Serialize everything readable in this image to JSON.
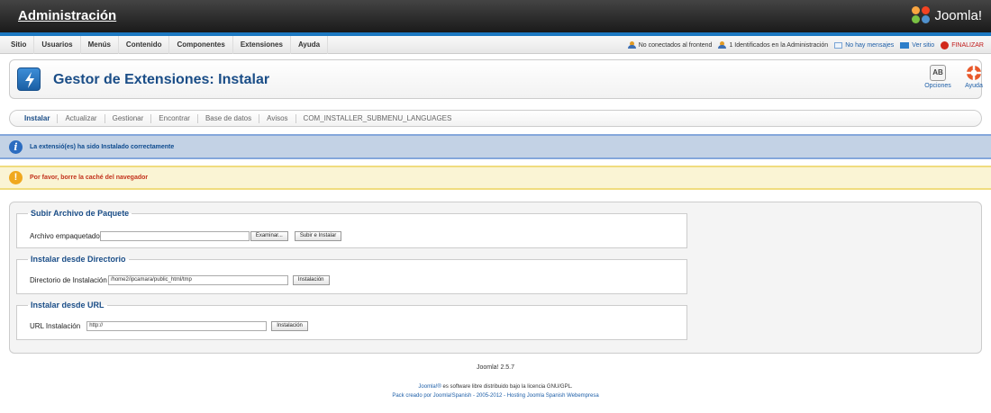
{
  "header": {
    "admin_title": "Administración",
    "logo_text": "Joomla!"
  },
  "menu": {
    "items": [
      "Sitio",
      "Usuarios",
      "Menús",
      "Contenido",
      "Componentes",
      "Extensiones",
      "Ayuda"
    ]
  },
  "status": {
    "frontend": "No conectados al frontend",
    "admin": "1 Identificados en la Administración",
    "messages": "No hay mensajes",
    "view_site": "Ver sitio",
    "logout": "FINALIZAR"
  },
  "toolbar": {
    "title": "Gestor de Extensiones: Instalar",
    "options_label": "Opciones",
    "help_label": "Ayuda"
  },
  "tabs": [
    "Instalar",
    "Actualizar",
    "Gestionar",
    "Encontrar",
    "Base de datos",
    "Avisos",
    "COM_INSTALLER_SUBMENU_LANGUAGES"
  ],
  "messages": {
    "info": "La extensió(es) ha sido Instalado correctamente",
    "warning": "Por favor, borre la caché del navegador"
  },
  "package": {
    "legend": "Subir Archivo de Paquete",
    "label": "Archivo empaquetado",
    "file_value": "",
    "browse_button": "Examinar...",
    "submit_button": "Subir e Instalar"
  },
  "directory": {
    "legend": "Instalar desde Directorio",
    "label": "Directorio de Instalación",
    "value": "/home2/ipcamara/public_html/tmp",
    "button": "Instalación"
  },
  "url": {
    "legend": "Instalar desde URL",
    "label": "URL Instalación",
    "value": "http://",
    "button": "Instalación"
  },
  "footer": {
    "version": "Joomla! 2.5.7",
    "license_link": "Joomla!®",
    "license_text": " es software libre distribuido bajo la licencia GNU/GPL.",
    "credits": "Pack creado por Joomla!Spanish - 2005-2012 - Hosting Joomla Spanish Webempresa"
  },
  "colors": {
    "header_bg": "#1a1a1a",
    "accent_blue": "#1d79c2",
    "title_blue": "#1a4d87",
    "info_bg": "#c3d2e5",
    "warning_bg": "#faf4d4",
    "warning_text": "#c3331d"
  }
}
